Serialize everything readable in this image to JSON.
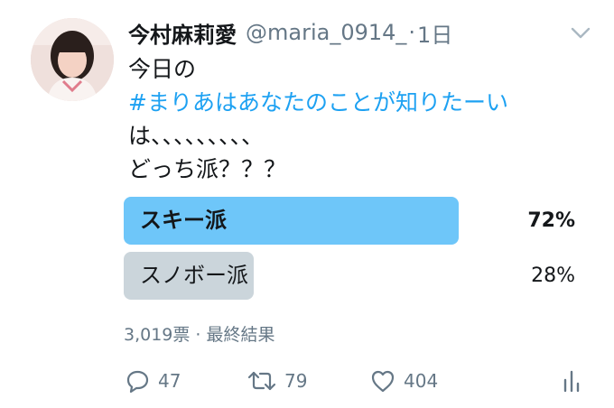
{
  "tweet": {
    "display_name": "今村麻莉愛",
    "handle": "@maria_0914_",
    "separator": "·",
    "time": "1日",
    "lines": [
      "今日の",
      "#まりあはあなたのことが知りたーい",
      "は、、、、、、、、、",
      "どっち派？？？"
    ]
  },
  "poll": {
    "options": [
      {
        "label": "スキー派",
        "percent_text": "72%",
        "percent": 72
      },
      {
        "label": "スノボー派",
        "percent_text": "28%",
        "percent": 28
      }
    ],
    "meta": "3,019票 · 最終結果"
  },
  "actions": {
    "reply_count": "47",
    "retweet_count": "79",
    "like_count": "404"
  },
  "icons": {
    "reply": "reply-icon",
    "retweet": "retweet-icon",
    "like": "heart-icon",
    "stats": "analytics-icon",
    "caret": "chevron-down-icon"
  },
  "colors": {
    "winner_bar": "#6ec6f9",
    "other_bar": "#cbd5db",
    "hashtag": "#1da1f2",
    "muted": "#657786"
  }
}
